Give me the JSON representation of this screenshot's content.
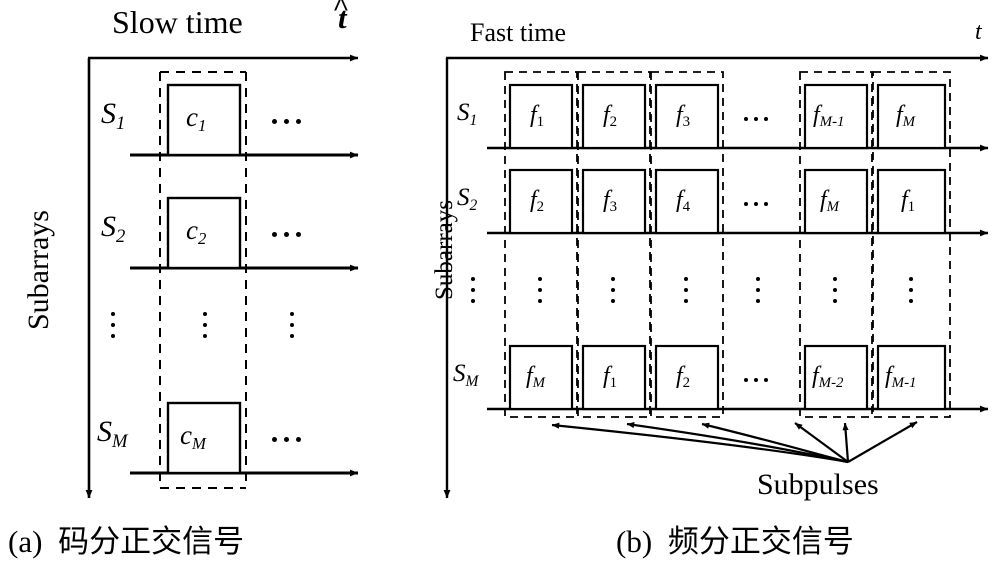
{
  "figure": {
    "panels": [
      {
        "id": "a",
        "caption_index": "(a)",
        "caption_text": "码分正交信号",
        "x_axis_label": "Slow time",
        "x_axis_symbol_base": "t",
        "x_axis_symbol_accent": "^",
        "y_axis_label": "Subarrays",
        "rows": [
          {
            "row_label_base": "S",
            "row_label_sub": "1",
            "pulse_base": "c",
            "pulse_sub": "1",
            "trailing_ellipsis": "…"
          },
          {
            "row_label_base": "S",
            "row_label_sub": "2",
            "pulse_base": "c",
            "pulse_sub": "2",
            "trailing_ellipsis": "…"
          },
          {
            "row_label_base": "",
            "row_label_sub": "",
            "pulse_base": "",
            "pulse_sub": "",
            "trailing_ellipsis": ""
          },
          {
            "row_label_base": "S",
            "row_label_sub": "M",
            "pulse_base": "c",
            "pulse_sub": "M",
            "trailing_ellipsis": "…"
          }
        ]
      },
      {
        "id": "b",
        "caption_index": "(b)",
        "caption_text": "频分正交信号",
        "x_axis_label": "Fast time",
        "x_axis_symbol_base": "t",
        "x_axis_symbol_accent": "",
        "y_axis_label": "Subarrays",
        "annotation_label": "Subpulses",
        "column_ellipsis": "⋯",
        "rows": [
          {
            "row_label_base": "S",
            "row_label_sub": "1",
            "cells": [
              {
                "base": "f",
                "sub": "1"
              },
              {
                "base": "f",
                "sub": "2"
              },
              {
                "base": "f",
                "sub": "3"
              },
              {
                "base": "f",
                "sub": "M-1"
              },
              {
                "base": "f",
                "sub": "M"
              }
            ]
          },
          {
            "row_label_base": "S",
            "row_label_sub": "2",
            "cells": [
              {
                "base": "f",
                "sub": "2"
              },
              {
                "base": "f",
                "sub": "3"
              },
              {
                "base": "f",
                "sub": "4"
              },
              {
                "base": "f",
                "sub": "M"
              },
              {
                "base": "f",
                "sub": "1"
              }
            ]
          },
          {
            "row_label_base": "S",
            "row_label_sub": "M",
            "cells": [
              {
                "base": "f",
                "sub": "M"
              },
              {
                "base": "f",
                "sub": "1"
              },
              {
                "base": "f",
                "sub": "2"
              },
              {
                "base": "f",
                "sub": "M-2"
              },
              {
                "base": "f",
                "sub": "M-1"
              }
            ]
          }
        ]
      }
    ],
    "colors": {
      "ink": "#000000",
      "background": "#ffffff"
    }
  }
}
